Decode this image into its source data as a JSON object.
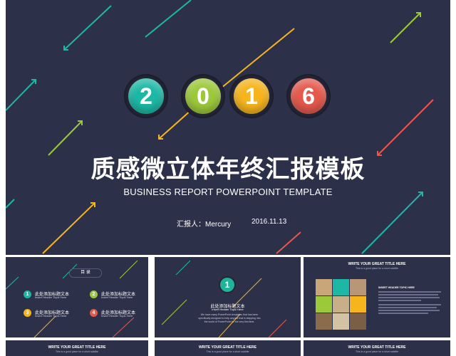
{
  "main": {
    "digits": [
      "2",
      "0",
      "1",
      "6"
    ],
    "digit_colors": [
      "#1cb8a5",
      "#9cc93a",
      "#f6b41d",
      "#e5594c"
    ],
    "title": "质感微立体年终汇报模板",
    "subtitle": "BUSINESS REPORT POWERPOINT TEMPLATE",
    "reporter": "汇报人：Mercury",
    "date": "2016.11.13"
  },
  "colors": {
    "background": "#2d3049",
    "teal": "#1cb8a5",
    "green": "#9cc93a",
    "yellow": "#f6b41d",
    "red": "#e5594c"
  },
  "thumbs": {
    "toc": {
      "label": "目 录",
      "items": [
        {
          "num": "1",
          "cn": "此处添加标题文本",
          "en": "Insert Header Topic Here"
        },
        {
          "num": "2",
          "cn": "此处添加标题文本",
          "en": "Insert Header Topic Here"
        },
        {
          "num": "3",
          "cn": "此处添加标题文本",
          "en": "Insert Header Topic Here"
        },
        {
          "num": "4",
          "cn": "此处添加标题文本",
          "en": "Insert Header Topic Here"
        }
      ]
    },
    "section": {
      "num": "1",
      "cn": "此处添加标题文本",
      "en": "Insert Header Topic Here",
      "desc": "We have many PowerPoint templates that has been specifically designed to help anyone that is stepping into the world of PowerPoint for the very first time."
    },
    "photo_slide": {
      "title": "WRITE YOUR GREAT TITLE HERE",
      "subtitle": "This is a good place for a short subtitle",
      "side_heading": "INSERT HEADER TOPIC HERE"
    },
    "bottom": [
      {
        "title": "WRITE YOUR GREAT TITLE HERE",
        "subtitle": "This is a good place for a short subtitle"
      },
      {
        "title": "WRITE YOUR GREAT TITLE HERE",
        "subtitle": "This is a good place for a short subtitle"
      },
      {
        "title": "WRITE YOUR GREAT TITLE HERE",
        "subtitle": "This is a good place for a short subtitle"
      }
    ]
  }
}
